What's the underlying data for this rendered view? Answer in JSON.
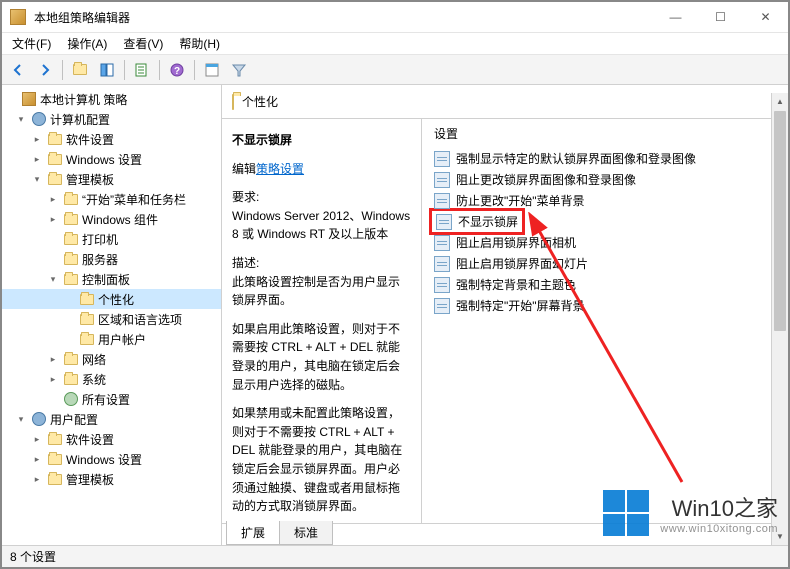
{
  "window": {
    "title": "本地组策略编辑器",
    "controls": {
      "min": "—",
      "max": "☐",
      "close": "✕"
    }
  },
  "menu": {
    "file": "文件(F)",
    "action": "操作(A)",
    "view": "查看(V)",
    "help": "帮助(H)"
  },
  "tree": {
    "root": "本地计算机 策略",
    "computer": "计算机配置",
    "soft1": "软件设置",
    "win1": "Windows 设置",
    "admin1": "管理模板",
    "startTaskbar": "“开始”菜单和任务栏",
    "winComp": "Windows 组件",
    "printer": "打印机",
    "server": "服务器",
    "ctrlPanel": "控制面板",
    "personalization": "个性化",
    "region": "区域和语言选项",
    "userAcct": "用户帐户",
    "network": "网络",
    "system": "系统",
    "allSettings": "所有设置",
    "user": "用户配置",
    "soft2": "软件设置",
    "win2": "Windows 设置",
    "admin2": "管理模板"
  },
  "preview": {
    "header": "个性化",
    "item_title": "不显示锁屏",
    "edit_prefix": "编辑",
    "edit_link": "策略设置",
    "req_label": "要求:",
    "req_text": "Windows Server 2012、Windows 8 或 Windows RT 及以上版本",
    "desc_label": "描述:",
    "desc1": "此策略设置控制是否为用户显示锁屏界面。",
    "desc2": "如果启用此策略设置，则对于不需要按 CTRL + ALT + DEL  就能登录的用户，其电脑在锁定后会显示用户选择的磁贴。",
    "desc3": "如果禁用或未配置此策略设置，则对于不需要按 CTRL + ALT + DEL 就能登录的用户，其电脑在锁定后会显示锁屏界面。用户必须通过触摸、键盘或者用鼠标拖动的方式取消锁屏界面。",
    "col_header": "设置",
    "items": [
      "强制显示特定的默认锁屏界面图像和登录图像",
      "阻止更改锁屏界面图像和登录图像",
      "防止更改\"开始\"菜单背景",
      "不显示锁屏",
      "阻止启用锁屏界面相机",
      "阻止启用锁屏界面幻灯片",
      "强制特定背景和主题色",
      "强制特定\"开始\"屏幕背景"
    ],
    "tabs": {
      "ext": "扩展",
      "std": "标准"
    }
  },
  "status": "8 个设置",
  "watermark": {
    "big": "Win10之家",
    "url": "www.win10xitong.com"
  }
}
